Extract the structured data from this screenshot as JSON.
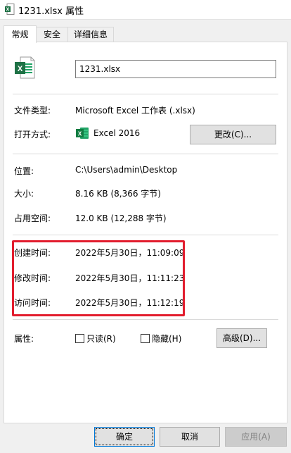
{
  "window": {
    "title": "1231.xlsx 属性"
  },
  "tabs": [
    {
      "label": "常规"
    },
    {
      "label": "安全"
    },
    {
      "label": "详细信息"
    }
  ],
  "general": {
    "filename": "1231.xlsx",
    "file_type_label": "文件类型:",
    "file_type_value": "Microsoft Excel 工作表 (.xlsx)",
    "opens_with_label": "打开方式:",
    "opens_with_app": "Excel 2016",
    "change_button": "更改(C)...",
    "location_label": "位置:",
    "location_value": "C:\\Users\\admin\\Desktop",
    "size_label": "大小:",
    "size_value": "8.16 KB (8,366 字节)",
    "size_on_disk_label": "占用空间:",
    "size_on_disk_value": "12.0 KB (12,288 字节)",
    "created_label": "创建时间:",
    "created_value": "2022年5月30日，11:09:09",
    "modified_label": "修改时间:",
    "modified_value": "2022年5月30日，11:11:23",
    "accessed_label": "访问时间:",
    "accessed_value": "2022年5月30日，11:12:19",
    "attributes_label": "属性:",
    "readonly_label": "只读(R)",
    "readonly_checked": false,
    "hidden_label": "隐藏(H)",
    "hidden_checked": false,
    "advanced_button": "高级(D)..."
  },
  "footer": {
    "ok": "确定",
    "cancel": "取消",
    "apply": "应用(A)"
  },
  "colors": {
    "excel_green": "#1e7145",
    "highlight_red": "#e21d2e",
    "focus_blue": "#0078d7"
  },
  "icons": {
    "title": "excel-file-icon",
    "file": "excel-file-icon",
    "app": "excel-app-icon"
  }
}
